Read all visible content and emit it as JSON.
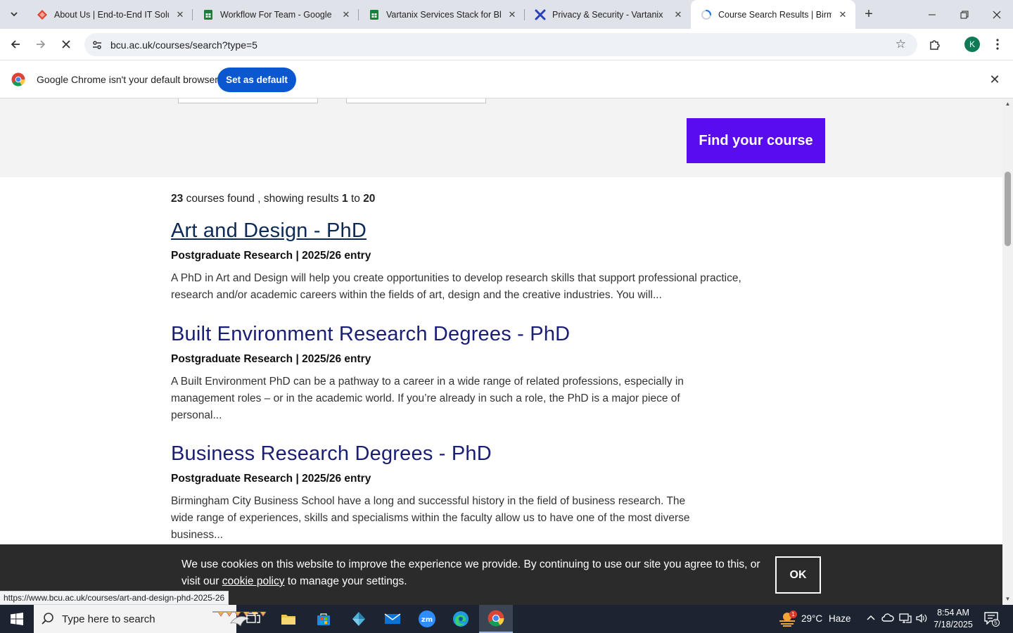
{
  "browser": {
    "tabs": [
      {
        "title": "About Us | End-to-End IT Soluti",
        "favicon": "red-diamond-icon"
      },
      {
        "title": "Workflow For Team - Google Sh",
        "favicon": "google-sheets-icon"
      },
      {
        "title": "Vartanix Services Stack for Blog",
        "favicon": "google-sheets-icon"
      },
      {
        "title": "Privacy & Security - Vartanix",
        "favicon": "vartanix-x-icon"
      },
      {
        "title": "Course Search Results | Birming",
        "favicon": "loading-icon",
        "active": true
      }
    ],
    "url": "bcu.ac.uk/courses/search?type=5",
    "profile_initial": "K"
  },
  "infobar": {
    "message": "Google Chrome isn't your default browser",
    "button": "Set as default"
  },
  "page": {
    "find_button": "Find your course",
    "results": {
      "total": "23",
      "text_1": "courses found , showing results",
      "from": "1",
      "to_word": "to",
      "to": "20"
    },
    "courses": [
      {
        "title": "Art and Design - PhD",
        "meta": "Postgraduate Research | 2025/26 entry",
        "description": "A PhD in Art and Design will help you create opportunities to develop research skills that support professional practice, research and/or academic careers within the fields of art, design and the creative industries.  You will..."
      },
      {
        "title": "Built Environment Research Degrees - PhD",
        "meta": "Postgraduate Research | 2025/26 entry",
        "description": "A Built Environment PhD can be a pathway to a career in a wide range of related professions, especially in management roles – or in the academic world.   If you’re already in such a role, the PhD is a major piece of personal..."
      },
      {
        "title": "Business Research Degrees - PhD",
        "meta": "Postgraduate Research | 2025/26 entry",
        "description": "Birmingham City Business School have a long and successful history in the field of business research. The wide range of experiences, skills and specialisms within the faculty allow us to have one of the most diverse business..."
      }
    ],
    "cookie": {
      "text_before": "We use cookies on this website to improve the experience we provide. By continuing to use our site you agree to this, or visit our",
      "link": "cookie policy",
      "text_after": "to manage your settings.",
      "ok": "OK"
    }
  },
  "status_url": "https://www.bcu.ac.uk/courses/art-and-design-phd-2025-26",
  "taskbar": {
    "search_placeholder": "Type here to search",
    "weather_temp": "29°C",
    "weather_desc": "Haze",
    "weather_badge": "1",
    "time": "8:54 AM",
    "date": "7/18/2025",
    "notification_count": "5"
  },
  "colors": {
    "accent_purple": "#5a0cf0",
    "course_link": "#1a1f73",
    "chrome_blue": "#0b57d0"
  }
}
